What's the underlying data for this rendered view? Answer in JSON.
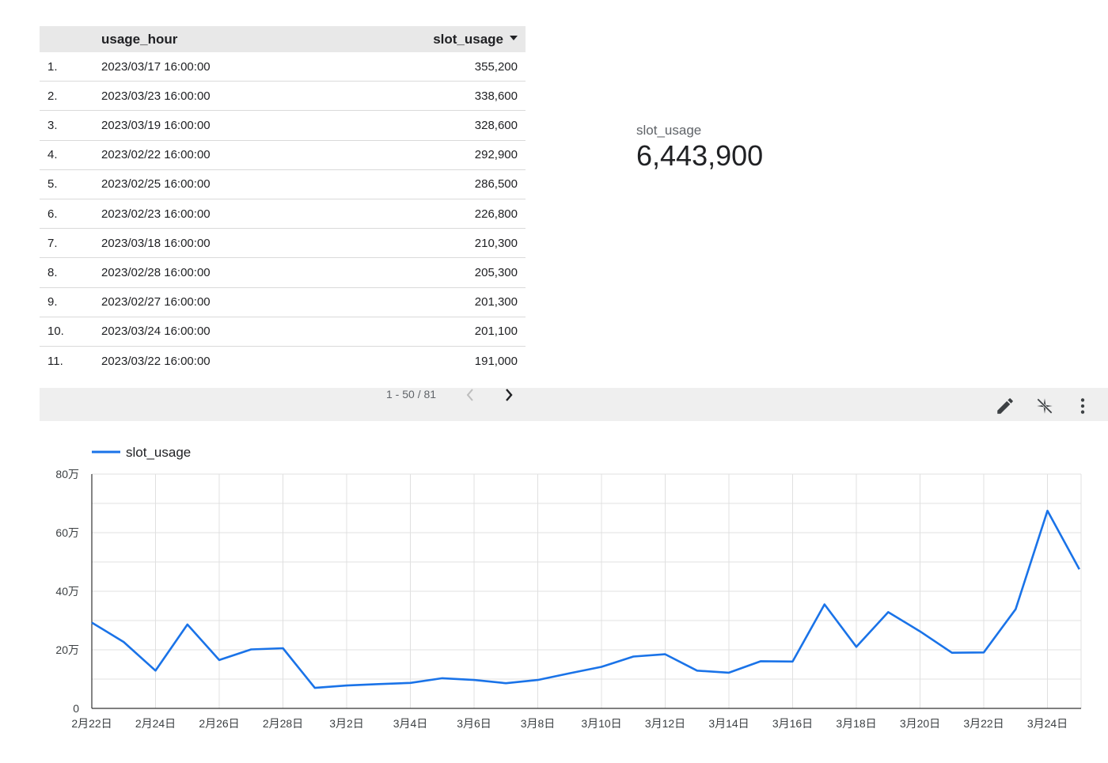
{
  "table": {
    "headers": {
      "hour": "usage_hour",
      "value": "slot_usage"
    },
    "rows": [
      {
        "index": "1.",
        "hour": "2023/03/17 16:00:00",
        "value": "355,200"
      },
      {
        "index": "2.",
        "hour": "2023/03/23 16:00:00",
        "value": "338,600"
      },
      {
        "index": "3.",
        "hour": "2023/03/19 16:00:00",
        "value": "328,600"
      },
      {
        "index": "4.",
        "hour": "2023/02/22 16:00:00",
        "value": "292,900"
      },
      {
        "index": "5.",
        "hour": "2023/02/25 16:00:00",
        "value": "286,500"
      },
      {
        "index": "6.",
        "hour": "2023/02/23 16:00:00",
        "value": "226,800"
      },
      {
        "index": "7.",
        "hour": "2023/03/18 16:00:00",
        "value": "210,300"
      },
      {
        "index": "8.",
        "hour": "2023/02/28 16:00:00",
        "value": "205,300"
      },
      {
        "index": "9.",
        "hour": "2023/02/27 16:00:00",
        "value": "201,300"
      },
      {
        "index": "10.",
        "hour": "2023/03/24 16:00:00",
        "value": "201,100"
      },
      {
        "index": "11.",
        "hour": "2023/03/22 16:00:00",
        "value": "191,000"
      }
    ],
    "pagination": "1 - 50 / 81"
  },
  "scorecard": {
    "label": "slot_usage",
    "value": "6,443,900"
  },
  "toolbar": {
    "icons": [
      "pencil-icon",
      "explore-icon",
      "more-vert-icon"
    ]
  },
  "colors": {
    "series": "#1a73e8",
    "grid": "#e0e0e0",
    "header_bg": "#e8e8e8"
  },
  "chart_data": {
    "type": "line",
    "legend_position": "top-left",
    "series": [
      {
        "name": "slot_usage",
        "x": [
          "2月22日",
          "2月23日",
          "2月24日",
          "2月25日",
          "2月26日",
          "2月27日",
          "2月28日",
          "3月1日",
          "3月2日",
          "3月3日",
          "3月4日",
          "3月5日",
          "3月6日",
          "3月7日",
          "3月8日",
          "3月9日",
          "3月10日",
          "3月11日",
          "3月12日",
          "3月13日",
          "3月14日",
          "3月15日",
          "3月16日",
          "3月17日",
          "3月18日",
          "3月19日",
          "3月20日",
          "3月21日",
          "3月22日",
          "3月23日",
          "3月24日",
          "3月25日"
        ],
        "values": [
          292900,
          226800,
          129000,
          286500,
          165000,
          201300,
          205300,
          70000,
          78000,
          83000,
          87000,
          103000,
          97000,
          86000,
          97000,
          120000,
          142000,
          177000,
          185000,
          129000,
          122000,
          161000,
          160000,
          355200,
          210300,
          328600,
          263000,
          190000,
          191000,
          338600,
          675000,
          475000
        ]
      }
    ],
    "x_tick_labels": [
      "2月22日",
      "2月24日",
      "2月26日",
      "2月28日",
      "3月2日",
      "3月4日",
      "3月6日",
      "3月8日",
      "3月10日",
      "3月12日",
      "3月14日",
      "3月16日",
      "3月18日",
      "3月20日",
      "3月22日",
      "3月24日"
    ],
    "y_tick_labels": [
      "0",
      "20万",
      "40万",
      "60万",
      "80万"
    ],
    "ylim": [
      0,
      800000
    ],
    "grid": true
  }
}
